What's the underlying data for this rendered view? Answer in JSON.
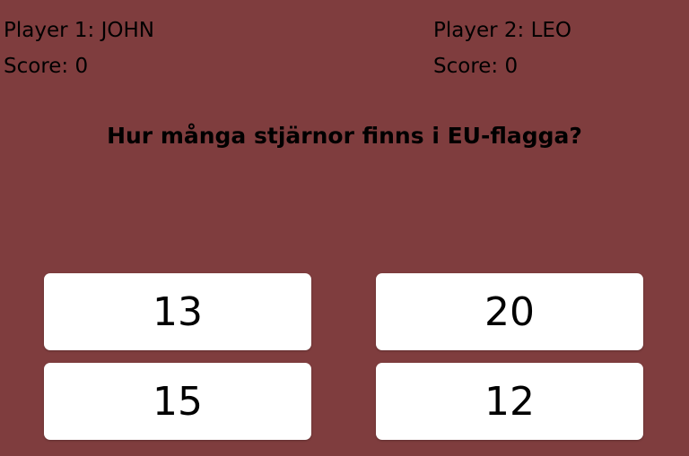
{
  "players": [
    {
      "label": "Player 1: JOHN",
      "score": "Score: 0"
    },
    {
      "label": "Player 2: LEO",
      "score": "Score: 0"
    }
  ],
  "question": "Hur många stjärnor finns i EU-flagga?",
  "answers": [
    "13",
    "20",
    "15",
    "12"
  ],
  "colors": {
    "background": "#7f3d3e",
    "button": "#ffffff",
    "text": "#000000"
  }
}
